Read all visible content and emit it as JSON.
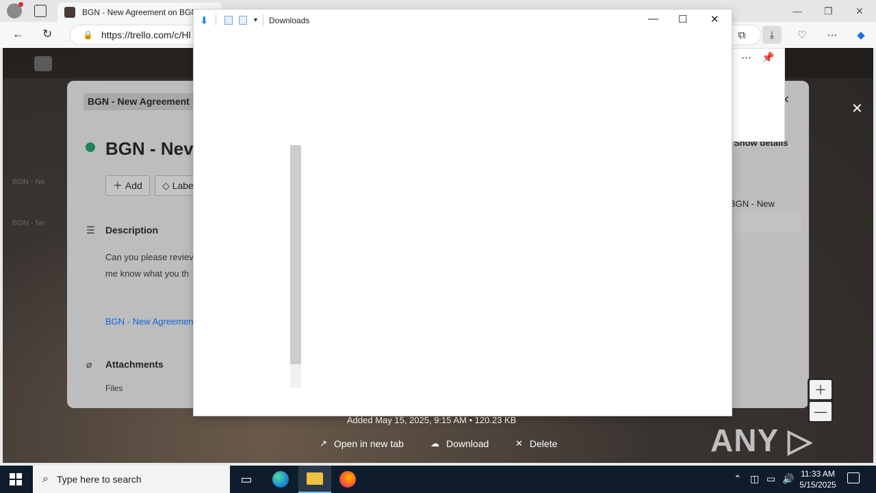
{
  "browser": {
    "tab_title": "BGN - New Agreement on BGN",
    "tab_close": "✕",
    "url": "https://trello.com/c/Hl",
    "toolbar_icons": [
      "collections-icon",
      "downloads-icon",
      "browser-essentials-icon",
      "more-icon",
      "copilot-icon"
    ]
  },
  "trello": {
    "breadcrumb": "BGN - New Agreement ⌄",
    "card_title": "BGN - Nev",
    "add_label": "Add",
    "labels_label": "Labe",
    "description_heading": "Description",
    "description_text_1": "Can you please reviev",
    "description_text_2": "me know what you th",
    "link_text": "BGN - New Agreemen",
    "attachments_heading": "Attachments",
    "files_label": "Files",
    "show_details": "Show details",
    "side_text": "BGN - New",
    "left_strip_1": "BGN - Ne",
    "left_strip_2": "BGN - Ne"
  },
  "downloads_window": {
    "title": "Downloads",
    "minimize": "—",
    "maximize": "☐",
    "close": "✕"
  },
  "download_bar": {
    "added_text": "Added May 15, 2025, 9:15 AM • 120.23 KB",
    "open_new_tab": "Open in new tab",
    "download": "Download",
    "delete": "Delete"
  },
  "watermark": "ANY ▷ RUN",
  "taskbar": {
    "search_placeholder": "Type here to search",
    "time": "11:33 AM",
    "date": "5/15/2025"
  }
}
